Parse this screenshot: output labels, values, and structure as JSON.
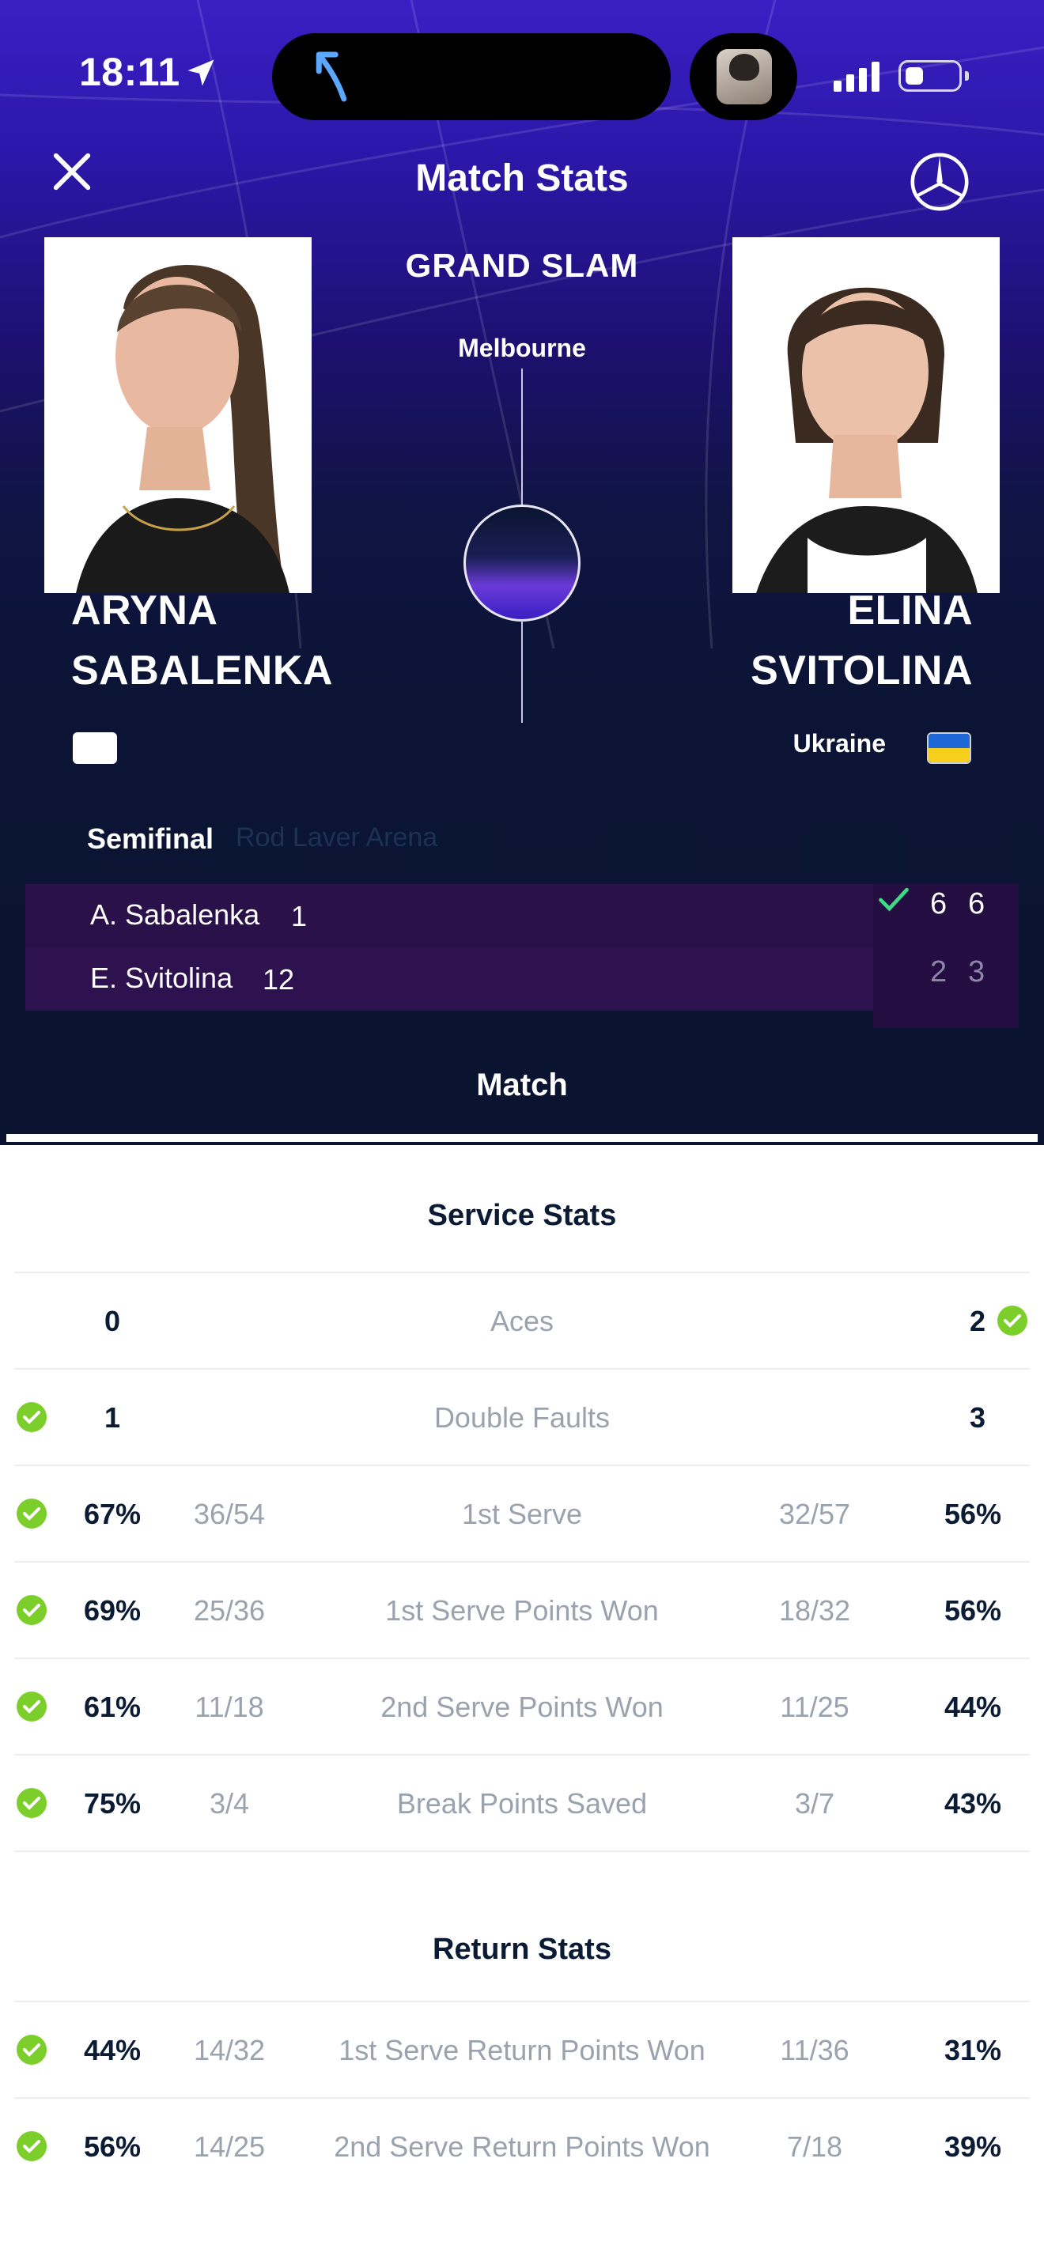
{
  "status_bar": {
    "time": "18:11"
  },
  "header": {
    "title": "Match Stats"
  },
  "tournament": {
    "name": "GRAND SLAM",
    "city": "Melbourne"
  },
  "players": {
    "left": {
      "first": "ARYNA",
      "last": "SABALENKA",
      "country": ""
    },
    "right": {
      "first": "ELINA",
      "last": "SVITOLINA",
      "country": "Ukraine"
    }
  },
  "match": {
    "round": "Semifinal",
    "venue": "Rod Laver Arena",
    "rows": [
      {
        "name": "A. Sabalenka",
        "seed": "1",
        "sets": [
          "6",
          "6"
        ],
        "winner": true
      },
      {
        "name": "E. Svitolina",
        "seed": "12",
        "sets": [
          "2",
          "3"
        ],
        "winner": false
      }
    ]
  },
  "tabs": {
    "match": "Match"
  },
  "colors": {
    "accent_green": "#7ccf2a",
    "hero_purple": "#3a1fc4",
    "navy": "#0a1430",
    "score_bg": "#2a1149"
  },
  "service_stats": {
    "title": "Service Stats",
    "rows": [
      {
        "label": "Aces",
        "left": "0",
        "right": "2",
        "left_frac": "",
        "right_frac": "",
        "winner": "right"
      },
      {
        "label": "Double Faults",
        "left": "1",
        "right": "3",
        "left_frac": "",
        "right_frac": "",
        "winner": "left"
      },
      {
        "label": "1st Serve",
        "left": "67%",
        "left_frac": "36/54",
        "right_frac": "32/57",
        "right": "56%",
        "winner": "left"
      },
      {
        "label": "1st Serve Points Won",
        "left": "69%",
        "left_frac": "25/36",
        "right_frac": "18/32",
        "right": "56%",
        "winner": "left"
      },
      {
        "label": "2nd Serve Points Won",
        "left": "61%",
        "left_frac": "11/18",
        "right_frac": "11/25",
        "right": "44%",
        "winner": "left"
      },
      {
        "label": "Break Points Saved",
        "left": "75%",
        "left_frac": "3/4",
        "right_frac": "3/7",
        "right": "43%",
        "winner": "left"
      }
    ]
  },
  "return_stats": {
    "title": "Return Stats",
    "rows": [
      {
        "label": "1st Serve Return Points Won",
        "left": "44%",
        "left_frac": "14/32",
        "right_frac": "11/36",
        "right": "31%",
        "winner": "left"
      },
      {
        "label": "2nd Serve Return Points Won",
        "left": "56%",
        "left_frac": "14/25",
        "right_frac": "7/18",
        "right": "39%",
        "winner": "left"
      }
    ]
  }
}
